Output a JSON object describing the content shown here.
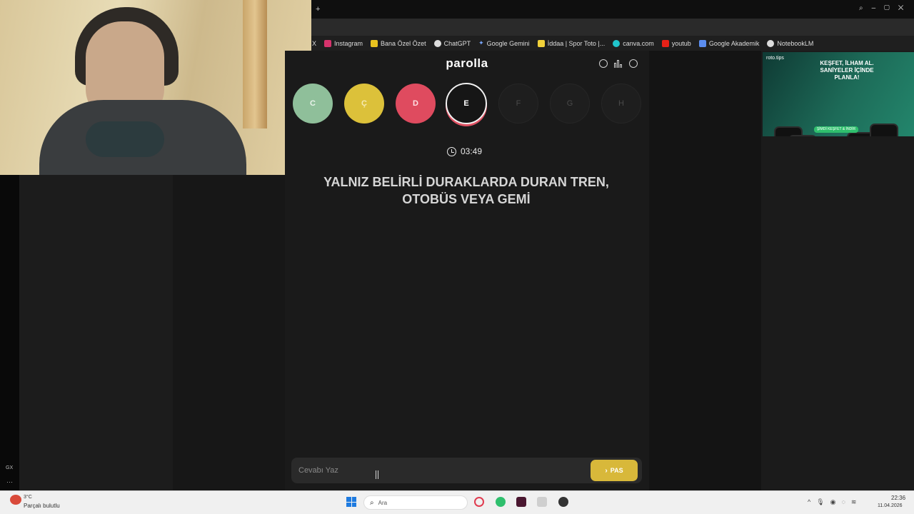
{
  "bookmarks": [
    {
      "label": "X",
      "color": "#1f1f1f"
    },
    {
      "label": "Instagram",
      "color": "#d6336c"
    },
    {
      "label": "Bana Özel Özet",
      "color": "#e8c21f"
    },
    {
      "label": "ChatGPT",
      "color": "#dddddd"
    },
    {
      "label": "Google Gemini",
      "color": "#7aa7ff"
    },
    {
      "label": "İddaa | Spor Toto |...",
      "color": "#f1d13a"
    },
    {
      "label": "canva.com",
      "color": "#20c4cb"
    },
    {
      "label": "youtub",
      "color": "#e62117"
    },
    {
      "label": "Google Akademik",
      "color": "#5b8def"
    },
    {
      "label": "NotebookLM",
      "color": "#dddddd"
    }
  ],
  "game": {
    "brand": "parolla",
    "letters": {
      "c": "C",
      "cc": "Ç",
      "d": "D",
      "e": "E",
      "f": "F",
      "g": "G",
      "h": "H"
    },
    "timer": "03:49",
    "question": "YALNIZ BELİRLİ DURAKLARDA DURAN TREN, OTOBÜS VEYA GEMİ",
    "answer_placeholder": "Cevabı Yaz",
    "pass_label": "PAS"
  },
  "sidebar": {
    "gx_label": "GX"
  },
  "ad": {
    "brand": "roto.tips",
    "headline": "KEŞFET, İLHAM AL. SANİYELER İÇİNDE PLANLA!",
    "cta": "ŞİMDİ KEŞFET & İNDİR"
  },
  "taskbar": {
    "weather_temp": "3°C",
    "weather_desc": "Parçalı bulutlu",
    "search_placeholder": "Ara",
    "time": "22:36",
    "date": "11.04.2026"
  },
  "colors": {
    "letter_c": "#8fbf9a",
    "letter_cc": "#dcc13a",
    "letter_d": "#df4b5f",
    "pass_button": "#d8b83a"
  }
}
